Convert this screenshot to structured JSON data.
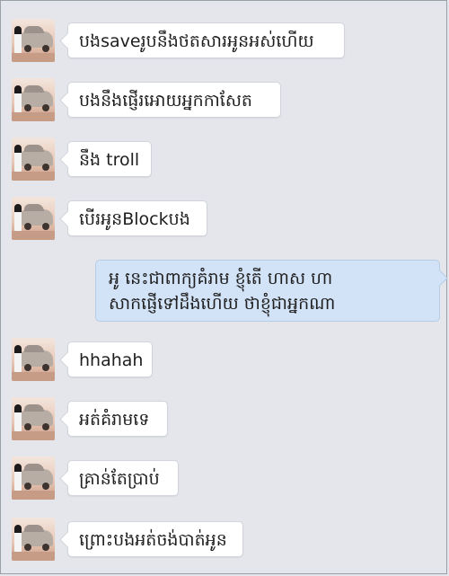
{
  "messages": [
    {
      "side": "incoming",
      "text": "បងsaveរូបនឹងថតសារអូនអស់ហើយ"
    },
    {
      "side": "incoming",
      "text": "បងនឹងផ្ញើរអោយអ្នកកាសែត"
    },
    {
      "side": "incoming",
      "text": "នឹង troll"
    },
    {
      "side": "incoming",
      "text": "បើរអូនBlockបង"
    },
    {
      "side": "outgoing",
      "lines": [
        "អូ នេះជាពាក្យគំរាម ខ្ញុំតើ ហាស ហា",
        "សាកផ្ញើទៅដឹងហើយ ថាខ្ញុំជាអ្នកណា"
      ]
    },
    {
      "side": "incoming",
      "text": "hhahah"
    },
    {
      "side": "incoming",
      "text": "អត់គំរាមទេ"
    },
    {
      "side": "incoming",
      "text": "គ្រាន់តែប្រាប់"
    },
    {
      "side": "incoming",
      "text": "ព្រោះបងអត់ចង់បាត់អូន"
    }
  ],
  "colors": {
    "background": "#e4e6ec",
    "incoming_bubble": "#ffffff",
    "outgoing_bubble": "#d3e3f7"
  },
  "icons": {
    "avatar": "contact-avatar-photo"
  }
}
